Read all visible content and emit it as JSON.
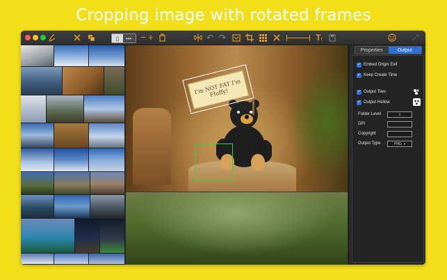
{
  "banner": {
    "title": "Cropping image with rotated frames"
  },
  "colors": {
    "background": "#f2df1c",
    "accent": "#d99a2b",
    "tab_active": "#2e6fd6",
    "frame_white": "#ffffff",
    "frame_green": "#39d339"
  },
  "toolbar": {
    "icons": [
      "brush-icon",
      "close-icon",
      "duplicate-icon",
      "segmented-control",
      "minus-icon",
      "plus-icon",
      "layers-icon",
      "flip-icon",
      "undo-icon",
      "redo-icon",
      "frame-icon",
      "crop-icon",
      "grid-icon",
      "cross-icon",
      "slider",
      "text-icon",
      "save-icon",
      "smiley-icon",
      "export-icon"
    ],
    "seg_left": "▯",
    "seg_right": "•••",
    "minus": "−",
    "plus": "+"
  },
  "canvas": {
    "sign_text": "I'm NOT FAT I'm Fluffy!"
  },
  "panel": {
    "tabs": [
      "Properties",
      "Output"
    ],
    "active_tab": "Output",
    "checkboxes": [
      {
        "label": "Embed Origin Exif",
        "checked": true
      },
      {
        "label": "Keep Create Time",
        "checked": true
      },
      {
        "label": "Output Tiles",
        "checked": true
      },
      {
        "label": "Output Hollow",
        "checked": true
      }
    ],
    "fields": [
      {
        "label": "Folder Level",
        "value": "1"
      },
      {
        "label": "DPI",
        "value": ""
      },
      {
        "label": "Copyright",
        "value": ""
      },
      {
        "label": "Output Type",
        "value": "PNG"
      }
    ]
  }
}
